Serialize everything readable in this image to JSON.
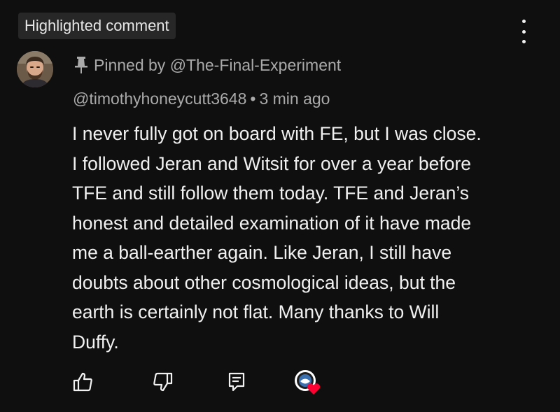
{
  "badge": {
    "label": "Highlighted comment"
  },
  "header": {
    "more_icon": "vertical-dots-icon"
  },
  "comment": {
    "pinned_label": "Pinned by @The-Final-Experiment",
    "pin_icon": "pin-icon",
    "author": "@timothyhoneycutt3648",
    "separator": "•",
    "timestamp": "3 min ago",
    "text_lines": [
      "I never fully got on board with FE, but I was close.",
      "I followed Jeran and Witsit for over a year before",
      "TFE and still follow them today. TFE and Jeran’s",
      "honest and detailed examination of it have made",
      "me a ball-earther again. Like Jeran, I still have",
      "doubts about other cosmological ideas, but the",
      "earth is certainly not flat. Many thanks to Will",
      "Duffy."
    ]
  },
  "actions": {
    "like_icon": "thumbs-up-icon",
    "dislike_icon": "thumbs-down-icon",
    "reply_icon": "reply-icon",
    "creator_heart_icon": "creator-heart-icon"
  },
  "colors": {
    "background": "#0f0f0f",
    "badge_background": "#272727",
    "primary_text": "#f1f1f1",
    "secondary_text": "#aaaaaa",
    "heart": "#ff0033"
  }
}
